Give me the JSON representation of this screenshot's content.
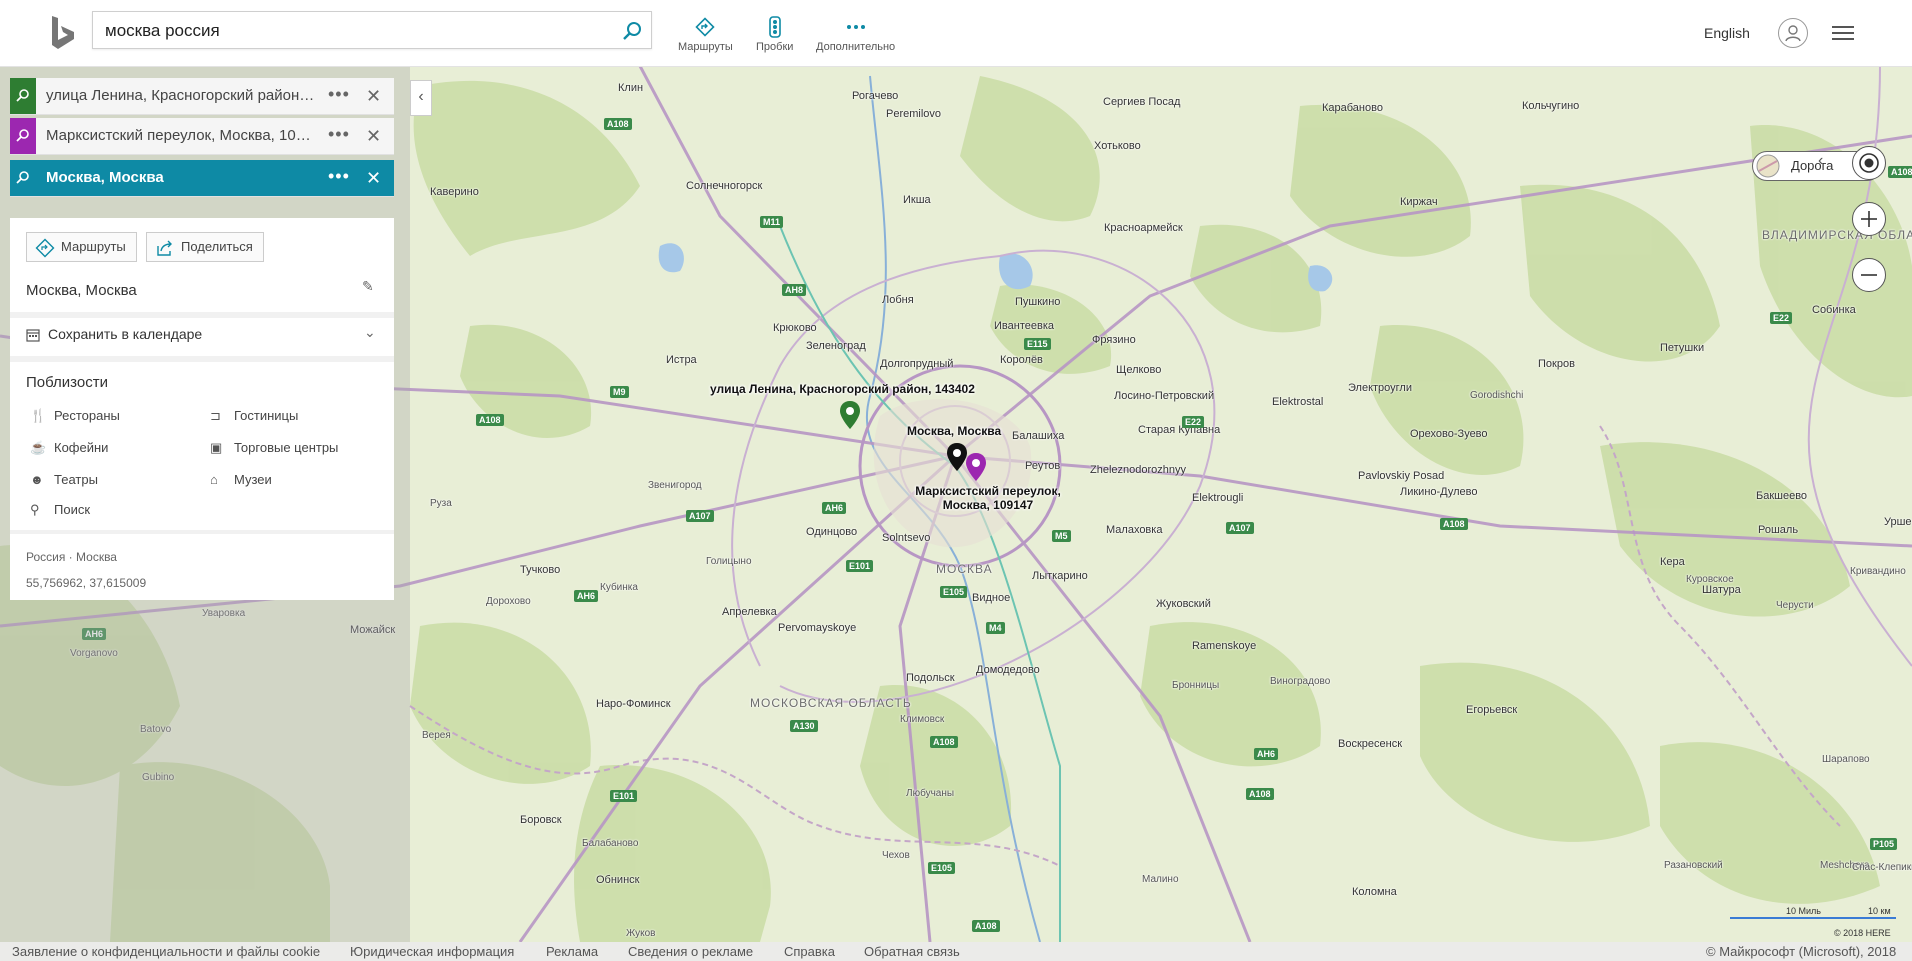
{
  "header": {
    "search_value": "москва россия",
    "tools": [
      {
        "label": "Маршруты",
        "icon": "directions-icon"
      },
      {
        "label": "Пробки",
        "icon": "traffic-icon"
      },
      {
        "label": "Дополнительно",
        "icon": "more-icon"
      }
    ],
    "language": "English"
  },
  "waypoints": [
    {
      "text": "улица Ленина, Красногорский район, 143402",
      "color": "#2e7d32"
    },
    {
      "text": "Марксистский переулок, Москва, 109147",
      "color": "#9c27b0"
    },
    {
      "text": "Москва, Москва",
      "color": "#0e8aa5"
    }
  ],
  "panel": {
    "routes_label": "Маршруты",
    "share_label": "Поделиться",
    "title": "Москва, Москва",
    "calendar_label": "Сохранить в календаре",
    "nearby_title": "Поблизости",
    "nearby": [
      {
        "label": "Рестораны",
        "icon": "restaurant-icon"
      },
      {
        "label": "Гостиницы",
        "icon": "hotel-icon"
      },
      {
        "label": "Кофейни",
        "icon": "coffee-icon"
      },
      {
        "label": "Торговые центры",
        "icon": "shopping-icon"
      },
      {
        "label": "Театры",
        "icon": "theater-icon"
      },
      {
        "label": "Музеи",
        "icon": "museum-icon"
      },
      {
        "label": "Поиск",
        "icon": "search-icon"
      }
    ],
    "location_path": "Россия · Москва",
    "coordinates": "55,756962, 37,615009"
  },
  "map": {
    "style_label": "Дорога",
    "pins": {
      "green_label": "улица Ленина, Красногорский район, 143402",
      "black_label": "Москва, Москва",
      "purple_label": "Марксистский переулок, Москва, 109147"
    },
    "places": [
      "Клин",
      "Рогачево",
      "Сергиев Посад",
      "Карабаново",
      "Кольчугино",
      "Peremilovo",
      "Хотьково",
      "Солнечногорск",
      "Икша",
      "Каверино",
      "Красноармейск",
      "Киржач",
      "ВЛАДИМИРСКАЯ ОБЛАСТЬ",
      "Лобня",
      "Пушкино",
      "Собинка",
      "Крюково",
      "Ивантеевка",
      "Фрязино",
      "Зеленоград",
      "Королёв",
      "Петушки",
      "Истра",
      "Долгопрудный",
      "Щелково",
      "Покров",
      "Лосино-Петровский",
      "Электроугли",
      "Elektrostal",
      "Gorodishchi",
      "Старая Купавна",
      "Балашиха",
      "Орехово-Зуево",
      "Zheleznodorozhnyy",
      "Реутов",
      "Pavlovskiy Posad",
      "Ликино-Дулево",
      "Звенигород",
      "Руза",
      "Одинцово",
      "Solntsevo",
      "Elektrougli",
      "Малаховка",
      "Бакшеево",
      "Рошаль",
      "Урше",
      "МОСКВА",
      "Лыткарино",
      "Голицыно",
      "Тучково",
      "Кубинка",
      "Видное",
      "Кривандино",
      "Кера",
      "Куровское",
      "Шатура",
      "Черусти",
      "Апрелевка",
      "Жуковский",
      "Дорохово",
      "Pervomayskoye",
      "Ramenskoye",
      "Можайск",
      "Уваровка",
      "Домодедово",
      "Подольск",
      "Vorganovo",
      "Бронницы",
      "Виноградово",
      "Наро-Фоминск",
      "МОСКОВСКАЯ ОБЛАСТЬ",
      "Егорьевск",
      "Климовск",
      "Batovo",
      "Верея",
      "Воскресенск",
      "Gubino",
      "Любучаны",
      "Боровск",
      "Балабаново",
      "Чехов",
      "Разановский",
      "Обнинск",
      "Малино",
      "Коломна",
      "Жуков",
      "Meshchera",
      "Спас-Клепики",
      "Шарапово"
    ],
    "shields": [
      "A108",
      "A108",
      "M11",
      "AH8",
      "E115",
      "M9",
      "A108",
      "E22",
      "E22",
      "AH6",
      "A107",
      "M5",
      "E101",
      "E105",
      "AH6",
      "AH6",
      "M4",
      "A107",
      "A130",
      "A108",
      "E101",
      "E105",
      "A108",
      "AH6",
      "A108",
      "A108",
      "P105"
    ],
    "scale_miles": "10 Миль",
    "scale_km": "10 км",
    "copyright_map": "© 2018 HERE"
  },
  "footer": {
    "links": [
      "Заявление о конфиденциальности и файлы cookie",
      "Юридическая информация",
      "Реклама",
      "Сведения о рекламе",
      "Справка",
      "Обратная связь"
    ],
    "copyright": "© Майкрософт (Microsoft), 2018"
  }
}
